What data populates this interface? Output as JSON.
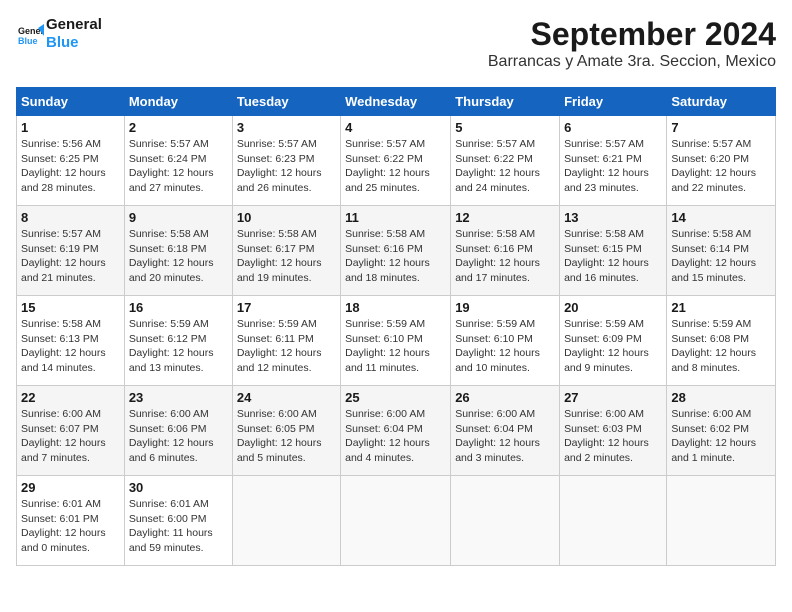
{
  "header": {
    "logo_line1": "General",
    "logo_line2": "Blue",
    "month_title": "September 2024",
    "location": "Barrancas y Amate 3ra. Seccion, Mexico"
  },
  "columns": [
    "Sunday",
    "Monday",
    "Tuesday",
    "Wednesday",
    "Thursday",
    "Friday",
    "Saturday"
  ],
  "weeks": [
    [
      {
        "day": "1",
        "sunrise": "5:56 AM",
        "sunset": "6:25 PM",
        "daylight": "12 hours and 28 minutes."
      },
      {
        "day": "2",
        "sunrise": "5:57 AM",
        "sunset": "6:24 PM",
        "daylight": "12 hours and 27 minutes."
      },
      {
        "day": "3",
        "sunrise": "5:57 AM",
        "sunset": "6:23 PM",
        "daylight": "12 hours and 26 minutes."
      },
      {
        "day": "4",
        "sunrise": "5:57 AM",
        "sunset": "6:22 PM",
        "daylight": "12 hours and 25 minutes."
      },
      {
        "day": "5",
        "sunrise": "5:57 AM",
        "sunset": "6:22 PM",
        "daylight": "12 hours and 24 minutes."
      },
      {
        "day": "6",
        "sunrise": "5:57 AM",
        "sunset": "6:21 PM",
        "daylight": "12 hours and 23 minutes."
      },
      {
        "day": "7",
        "sunrise": "5:57 AM",
        "sunset": "6:20 PM",
        "daylight": "12 hours and 22 minutes."
      }
    ],
    [
      {
        "day": "8",
        "sunrise": "5:57 AM",
        "sunset": "6:19 PM",
        "daylight": "12 hours and 21 minutes."
      },
      {
        "day": "9",
        "sunrise": "5:58 AM",
        "sunset": "6:18 PM",
        "daylight": "12 hours and 20 minutes."
      },
      {
        "day": "10",
        "sunrise": "5:58 AM",
        "sunset": "6:17 PM",
        "daylight": "12 hours and 19 minutes."
      },
      {
        "day": "11",
        "sunrise": "5:58 AM",
        "sunset": "6:16 PM",
        "daylight": "12 hours and 18 minutes."
      },
      {
        "day": "12",
        "sunrise": "5:58 AM",
        "sunset": "6:16 PM",
        "daylight": "12 hours and 17 minutes."
      },
      {
        "day": "13",
        "sunrise": "5:58 AM",
        "sunset": "6:15 PM",
        "daylight": "12 hours and 16 minutes."
      },
      {
        "day": "14",
        "sunrise": "5:58 AM",
        "sunset": "6:14 PM",
        "daylight": "12 hours and 15 minutes."
      }
    ],
    [
      {
        "day": "15",
        "sunrise": "5:58 AM",
        "sunset": "6:13 PM",
        "daylight": "12 hours and 14 minutes."
      },
      {
        "day": "16",
        "sunrise": "5:59 AM",
        "sunset": "6:12 PM",
        "daylight": "12 hours and 13 minutes."
      },
      {
        "day": "17",
        "sunrise": "5:59 AM",
        "sunset": "6:11 PM",
        "daylight": "12 hours and 12 minutes."
      },
      {
        "day": "18",
        "sunrise": "5:59 AM",
        "sunset": "6:10 PM",
        "daylight": "12 hours and 11 minutes."
      },
      {
        "day": "19",
        "sunrise": "5:59 AM",
        "sunset": "6:10 PM",
        "daylight": "12 hours and 10 minutes."
      },
      {
        "day": "20",
        "sunrise": "5:59 AM",
        "sunset": "6:09 PM",
        "daylight": "12 hours and 9 minutes."
      },
      {
        "day": "21",
        "sunrise": "5:59 AM",
        "sunset": "6:08 PM",
        "daylight": "12 hours and 8 minutes."
      }
    ],
    [
      {
        "day": "22",
        "sunrise": "6:00 AM",
        "sunset": "6:07 PM",
        "daylight": "12 hours and 7 minutes."
      },
      {
        "day": "23",
        "sunrise": "6:00 AM",
        "sunset": "6:06 PM",
        "daylight": "12 hours and 6 minutes."
      },
      {
        "day": "24",
        "sunrise": "6:00 AM",
        "sunset": "6:05 PM",
        "daylight": "12 hours and 5 minutes."
      },
      {
        "day": "25",
        "sunrise": "6:00 AM",
        "sunset": "6:04 PM",
        "daylight": "12 hours and 4 minutes."
      },
      {
        "day": "26",
        "sunrise": "6:00 AM",
        "sunset": "6:04 PM",
        "daylight": "12 hours and 3 minutes."
      },
      {
        "day": "27",
        "sunrise": "6:00 AM",
        "sunset": "6:03 PM",
        "daylight": "12 hours and 2 minutes."
      },
      {
        "day": "28",
        "sunrise": "6:00 AM",
        "sunset": "6:02 PM",
        "daylight": "12 hours and 1 minute."
      }
    ],
    [
      {
        "day": "29",
        "sunrise": "6:01 AM",
        "sunset": "6:01 PM",
        "daylight": "12 hours and 0 minutes."
      },
      {
        "day": "30",
        "sunrise": "6:01 AM",
        "sunset": "6:00 PM",
        "daylight": "11 hours and 59 minutes."
      },
      null,
      null,
      null,
      null,
      null
    ]
  ]
}
